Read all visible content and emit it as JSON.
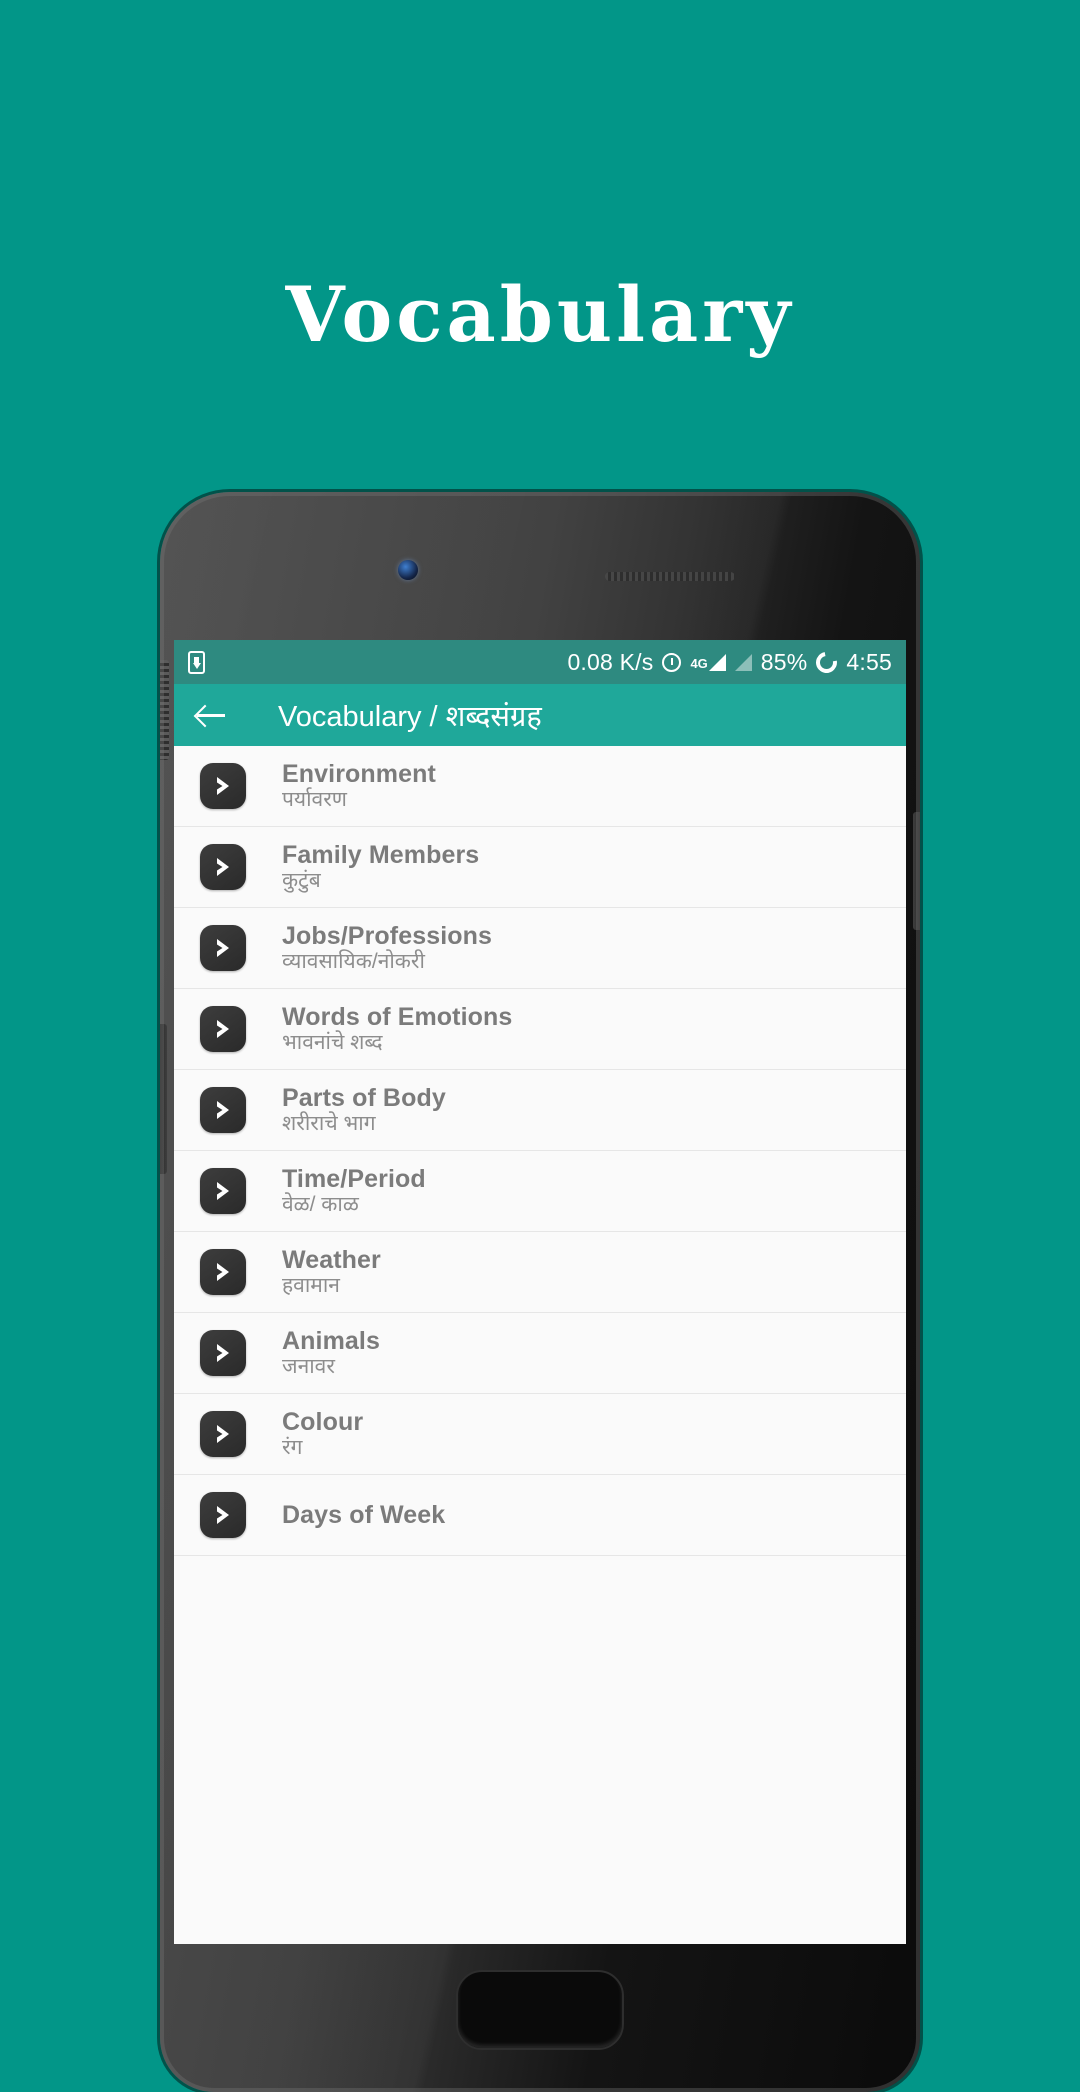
{
  "promo": {
    "title": "Vocabulary"
  },
  "colors": {
    "background_teal": "#029688",
    "appbar_teal": "#1fa89a",
    "statusbar_teal": "#2e8a80",
    "list_background": "#fafafa",
    "item_title": "#7b7b7b",
    "item_subtitle": "#8d8d8d",
    "icon_dark": "#2f2f2f"
  },
  "status_bar": {
    "download_icon": "download-icon",
    "network_speed": "0.08 K/s",
    "alarm_icon": "alarm-icon",
    "network_type": "4G",
    "signal_icon": "signal-bars-icon",
    "signal_icon_2": "signal-bars-empty-icon",
    "battery_percent": "85%",
    "battery_icon": "battery-circle-icon",
    "time": "4:55"
  },
  "app_bar": {
    "back_icon": "back-arrow-icon",
    "title": "Vocabulary / शब्दसंग्रह"
  },
  "list": {
    "item_icon": "chevron-right-icon",
    "items": [
      {
        "title": "Environment",
        "subtitle": "पर्यावरण"
      },
      {
        "title": "Family Members",
        "subtitle": "कुटुंब"
      },
      {
        "title": "Jobs/Professions",
        "subtitle": "व्यावसायिक/नोकरी"
      },
      {
        "title": "Words of Emotions",
        "subtitle": "भावनांचे शब्द"
      },
      {
        "title": "Parts of Body",
        "subtitle": "शरीराचे भाग"
      },
      {
        "title": "Time/Period",
        "subtitle": "वेळ/ काळ"
      },
      {
        "title": "Weather",
        "subtitle": "हवामान"
      },
      {
        "title": "Animals",
        "subtitle": "जनावर"
      },
      {
        "title": "Colour",
        "subtitle": "रंग"
      },
      {
        "title": "Days of Week",
        "subtitle": ""
      }
    ]
  },
  "device": {
    "front_camera": "front-camera-icon",
    "earpiece": "earpiece-speaker",
    "home_button": "home-button",
    "alert_slider": "alert-slider-button",
    "volume_button": "volume-button",
    "power_button": "power-button"
  }
}
